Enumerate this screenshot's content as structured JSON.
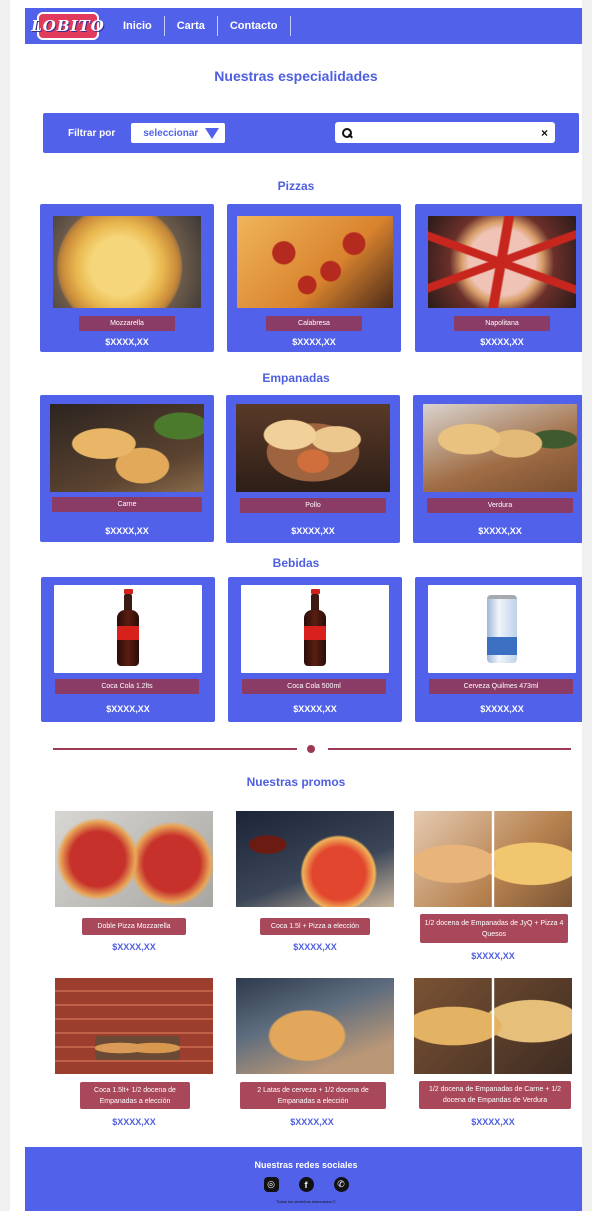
{
  "navbar": {
    "logo_text": "LOBITO",
    "links": [
      "Inicio",
      "Carta",
      "Contacto"
    ]
  },
  "main_title": "Nuestras especialidades",
  "filter": {
    "label": "Filtrar por",
    "select_value": "seleccionar",
    "search_placeholder": "",
    "clear_icon": "×"
  },
  "categories": {
    "pizzas": {
      "title": "Pizzas",
      "items": [
        {
          "name": "Mozzarella",
          "price": "$XXXX,XX"
        },
        {
          "name": "Calabresa",
          "price": "$XXXX,XX"
        },
        {
          "name": "Napolitana",
          "price": "$XXXX,XX"
        }
      ]
    },
    "empanadas": {
      "title": "Empanadas",
      "items": [
        {
          "name": "Carne",
          "price": "$XXXX,XX"
        },
        {
          "name": "Pollo",
          "price": "$XXXX,XX"
        },
        {
          "name": "Verdura",
          "price": "$XXXX,XX"
        }
      ]
    },
    "bebidas": {
      "title": "Bebidas",
      "items": [
        {
          "name": "Coca Cola 1.2lts",
          "price": "$XXXX,XX"
        },
        {
          "name": "Coca Cola 500ml",
          "price": "$XXXX,XX"
        },
        {
          "name": "Cerveza Quilmes 473ml",
          "price": "$XXXX,XX"
        }
      ]
    }
  },
  "promos": {
    "title": "Nuestras promos",
    "items": [
      {
        "name": "Doble Pizza Mozzarella",
        "price": "$XXXX,XX"
      },
      {
        "name": "Coca 1.5l + Pizza a elección",
        "price": "$XXXX,XX"
      },
      {
        "name": "1/2 docena de Empanadas de JyQ + Pizza 4 Quesos",
        "price": "$XXXX,XX"
      },
      {
        "name": "Coca 1.5lt+ 1/2 docena de Empanadas a elección",
        "price": "$XXXX,XX"
      },
      {
        "name": "2 Latas de cerveza + 1/2 docena de Empanadas a elección",
        "price": "$XXXX,XX"
      },
      {
        "name": "1/2 docena de Empanadas de Carne + 1/2 docena de Empandas de Verdura",
        "price": "$XXXX,XX"
      }
    ]
  },
  "footer": {
    "title": "Nuestras redes sociales",
    "icons": [
      "instagram-icon",
      "facebook-icon",
      "whatsapp-icon"
    ],
    "rights": "Todos los derechos reservados ©"
  },
  "colors": {
    "primary": "#5161ea",
    "label_bg": "#8b3c66",
    "promo_label_bg": "#a8485a",
    "title_text": "#4d5fe0"
  }
}
